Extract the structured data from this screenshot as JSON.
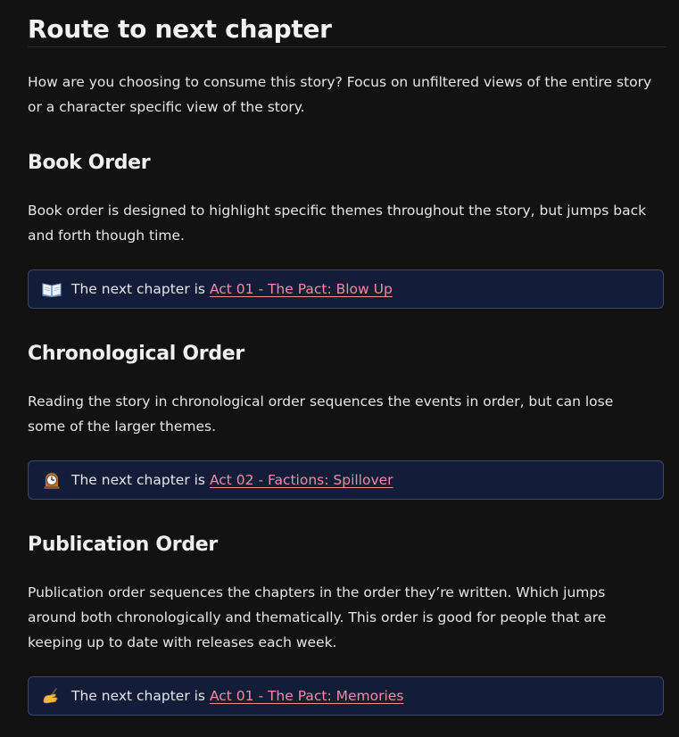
{
  "page": {
    "title": "Route to next chapter",
    "intro": "How are you choosing to consume this story? Focus on unfiltered views of the entire story or a character specific view of the story."
  },
  "sections": [
    {
      "heading": "Book Order",
      "description": "Book order is designed to highlight specific themes throughout the story, but jumps back and forth though time.",
      "callout": {
        "icon": "open-book-icon",
        "prefix": "The next chapter is",
        "link_text": "Act 01 - The Pact: Blow Up"
      }
    },
    {
      "heading": "Chronological Order",
      "description": "Reading the story in chronological order sequences the events in order, but can lose some of the larger themes.",
      "callout": {
        "icon": "mantelpiece-clock-icon",
        "prefix": "The next chapter is",
        "link_text": "Act 02 - Factions: Spillover"
      }
    },
    {
      "heading": "Publication Order",
      "description": "Publication order sequences the chapters in the order they’re written. Which jumps around both chronologically and thematically. This order is good for people that are keeping up to date with releases each week.",
      "callout": {
        "icon": "writing-hand-icon",
        "prefix": "The next chapter is",
        "link_text": "Act 01 - The Pact: Memories"
      }
    }
  ],
  "colors": {
    "background": "#121212",
    "callout_background": "#141d38",
    "callout_border": "#3c4668",
    "link": "#f08ba4"
  }
}
